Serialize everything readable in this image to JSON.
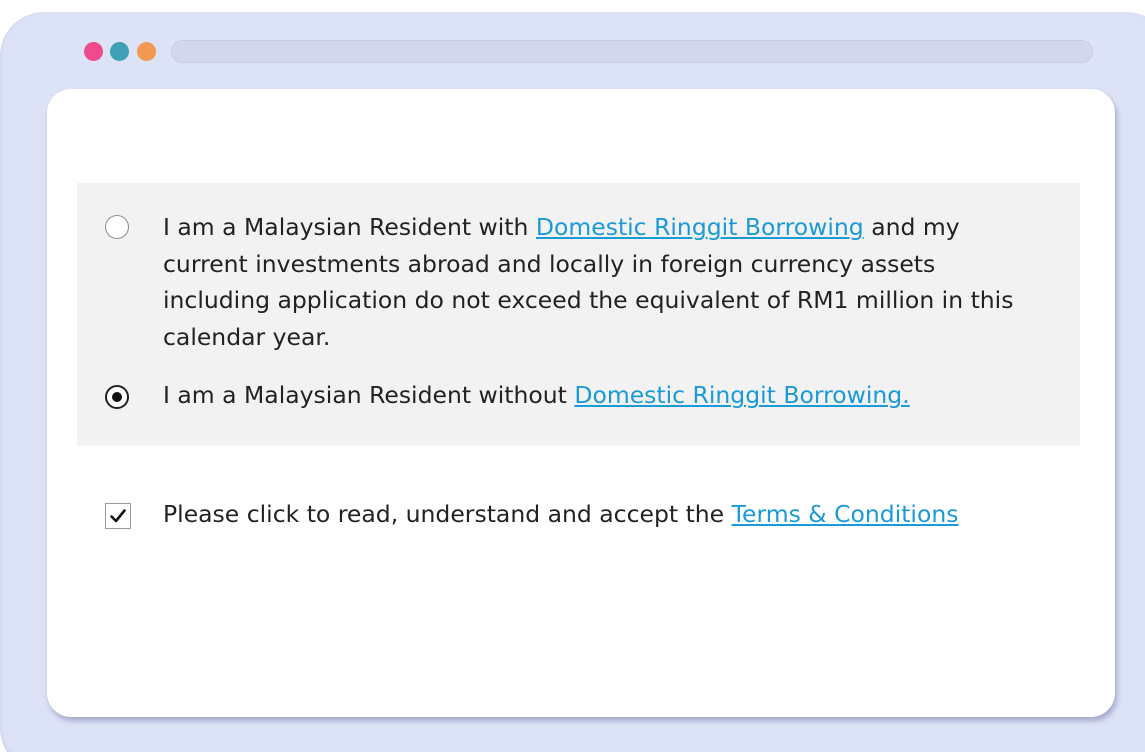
{
  "window": {
    "dots": [
      {
        "name": "red",
        "color": "#ef4a8e"
      },
      {
        "name": "teal",
        "color": "#3ea0b5"
      },
      {
        "name": "orange",
        "color": "#f39a52"
      }
    ]
  },
  "options": [
    {
      "selected": false,
      "text_before": "I am a Malaysian Resident with ",
      "link_text": "Domestic Ringgit Borrowing",
      "text_after": " and my current investments abroad and locally in foreign currency assets including application do not exceed the equivalent of RM1 million in this calendar year."
    },
    {
      "selected": true,
      "text_before": "I am a Malaysian Resident without ",
      "link_text": "Domestic Ringgit Borrowing.",
      "text_after": ""
    }
  ],
  "terms": {
    "checked": true,
    "text_before": "Please click to read, understand and accept the ",
    "link_text": "Terms & Conditions"
  },
  "colors": {
    "link": "#1a9ad6",
    "frame": "#dde3f7",
    "panel": "#f2f2f2"
  }
}
